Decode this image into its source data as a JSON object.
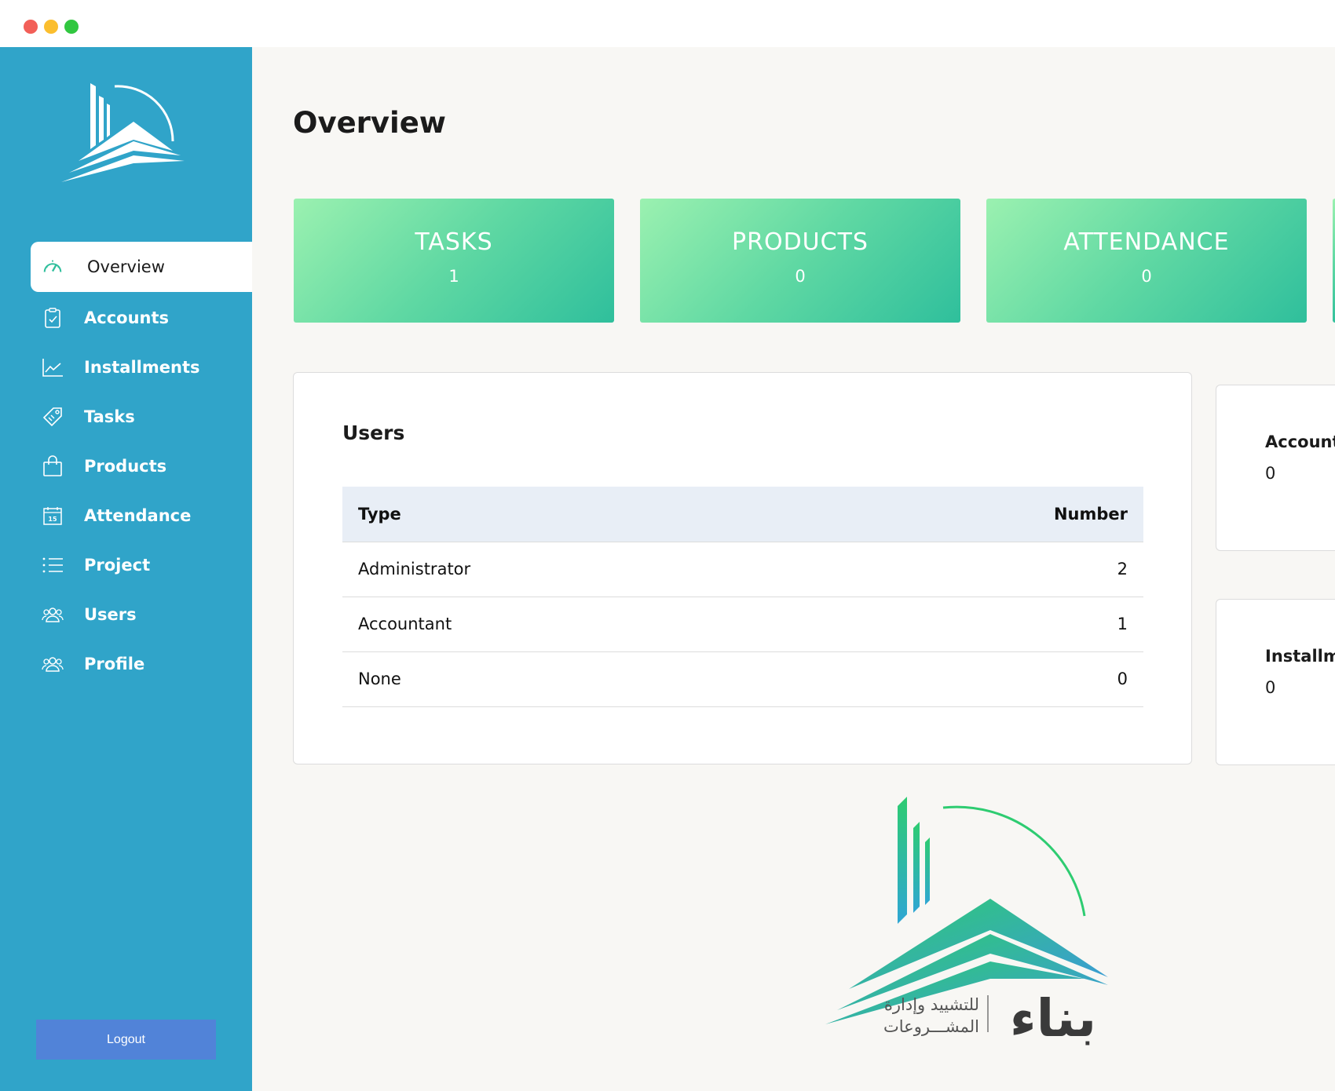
{
  "window": {
    "controls": [
      "close",
      "minimize",
      "maximize"
    ]
  },
  "sidebar": {
    "logo_icon": "building-logo",
    "items": [
      {
        "label": "Overview",
        "icon": "speedometer-icon",
        "active": true
      },
      {
        "label": "Accounts",
        "icon": "clipboard-check-icon"
      },
      {
        "label": "Installments",
        "icon": "line-chart-icon"
      },
      {
        "label": "Tasks",
        "icon": "tag-icon"
      },
      {
        "label": "Products",
        "icon": "shopping-bag-icon"
      },
      {
        "label": "Attendance",
        "icon": "calendar-icon",
        "calendar_day": "15"
      },
      {
        "label": "Project",
        "icon": "list-icon"
      },
      {
        "label": "Users",
        "icon": "users-icon"
      },
      {
        "label": "Profile",
        "icon": "users-icon"
      }
    ],
    "logout_label": "Logout"
  },
  "main": {
    "title": "Overview",
    "stats": [
      {
        "label": "TASKS",
        "value": "1"
      },
      {
        "label": "PRODUCTS",
        "value": "0"
      },
      {
        "label": "ATTENDANCE",
        "value": "0"
      }
    ],
    "users_panel": {
      "title": "Users",
      "columns": [
        "Type",
        "Number"
      ],
      "rows": [
        {
          "type": "Administrator",
          "number": "2"
        },
        {
          "type": "Accountant",
          "number": "1"
        },
        {
          "type": "None",
          "number": "0"
        }
      ]
    },
    "side_cards": [
      {
        "title": "Account",
        "value": "0"
      },
      {
        "title": "Installme",
        "value": "0"
      }
    ],
    "brand": {
      "line1": "للتشييد وإدارة",
      "line2": "المشـــروعات",
      "name": "بناء"
    }
  },
  "colors": {
    "sidebar": "#30a4c9",
    "card_gradient_start": "#9bf1b0",
    "card_gradient_end": "#2fbf9c",
    "logout": "#5183d8",
    "table_header": "#e8eef6",
    "main_bg": "#f8f7f4"
  }
}
